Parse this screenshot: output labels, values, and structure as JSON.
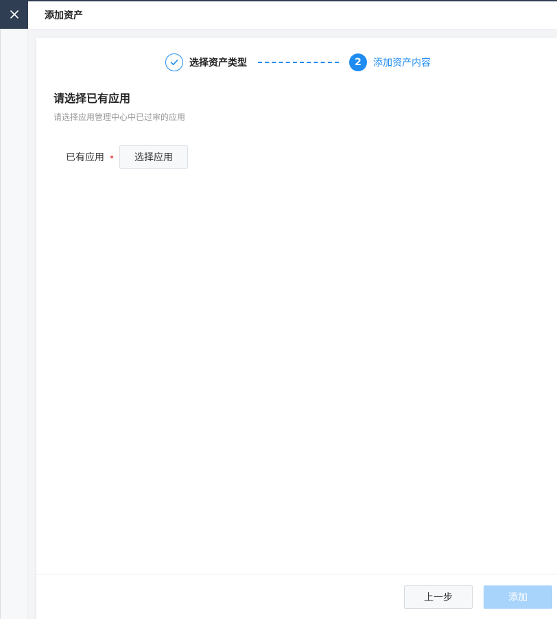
{
  "header": {
    "title": "添加资产"
  },
  "steps": [
    {
      "label": "选择资产类型",
      "status": "done"
    },
    {
      "number": "2",
      "label": "添加资产内容",
      "status": "active"
    }
  ],
  "section": {
    "title": "请选择已有应用",
    "description": "请选择应用管理中心中已过审的应用"
  },
  "form": {
    "existing_app_label": "已有应用",
    "select_button": "选择应用"
  },
  "footer": {
    "prev_label": "上一步",
    "add_label": "添加"
  },
  "colors": {
    "accent": "#1e8cf0",
    "sidebar_dark": "#2f3e52",
    "required": "#f25757",
    "disabled_primary": "#a8d3fb"
  }
}
